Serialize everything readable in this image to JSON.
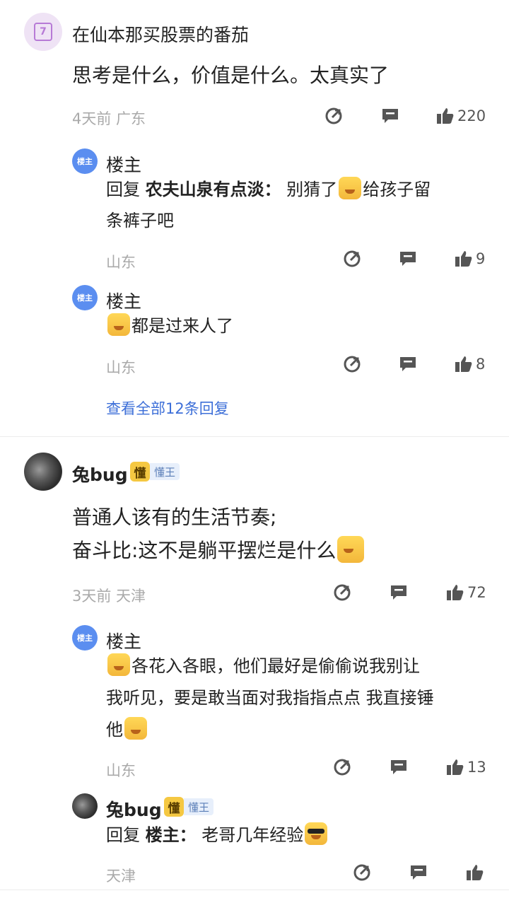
{
  "comments": [
    {
      "author": "在仙本那买股票的番茄",
      "avatar_icon": "calendar-icon",
      "avatar_text": "7",
      "text_lines": [
        "思考是什么，价值是什么。太真实了"
      ],
      "meta": "4天前  广东",
      "likes": "220",
      "replies": [
        {
          "author": "楼主",
          "avatar_text": "楼主",
          "reply_prefix": "回复",
          "reply_to": "农夫山泉有点淡：",
          "line1": "别猜了",
          "line1_after": "给孩子留",
          "line2": "条裤子吧",
          "meta": "山东",
          "likes": "9"
        },
        {
          "author": "楼主",
          "avatar_text": "楼主",
          "line1": "都是过来人了",
          "meta": "山东",
          "likes": "8"
        }
      ],
      "view_all": "查看全部12条回复"
    },
    {
      "author": "兔bug",
      "badge_icon_text": "懂",
      "badge_label": "懂王",
      "text_lines": [
        "普通人该有的生活节奏;",
        "奋斗比:这不是躺平摆烂是什么"
      ],
      "meta": "3天前  天津",
      "likes": "72",
      "replies": [
        {
          "author": "楼主",
          "avatar_text": "楼主",
          "line1": "各花入各眼，他们最好是偷偷说我别让",
          "line2": "我听见，要是敢当面对我指指点点 我直接锤",
          "line3": "他",
          "meta": "山东",
          "likes": "13"
        },
        {
          "author": "兔bug",
          "badge_icon_text": "懂",
          "badge_label": "懂王",
          "reply_prefix": "回复",
          "reply_to": "楼主：",
          "line1": "老哥几年经验",
          "meta": "天津"
        }
      ]
    }
  ]
}
